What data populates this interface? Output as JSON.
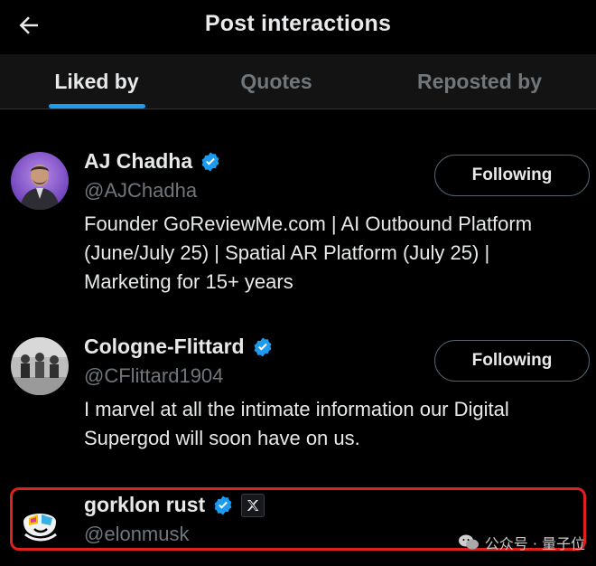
{
  "header": {
    "title": "Post interactions",
    "back_icon": "arrow-left-icon"
  },
  "tabs": [
    {
      "label": "Liked by",
      "active": true
    },
    {
      "label": "Quotes",
      "active": false
    },
    {
      "label": "Reposted by",
      "active": false
    }
  ],
  "users": [
    {
      "name": "AJ Chadha",
      "handle": "@AJChadha",
      "verified": true,
      "bio_lines": [
        "Founder GoReviewMe.com | AI Outbound Platform",
        "(June/July 25) | Spatial AR Platform (July 25) |",
        "Marketing for 15+ years"
      ],
      "button_label": "Following"
    },
    {
      "name": "Cologne-Flittard",
      "handle": "@CFlittard1904",
      "verified": true,
      "bio_lines": [
        "I marvel at all the intimate information our Digital",
        "Supergod will soon have on us."
      ],
      "button_label": "Following"
    },
    {
      "name": "gorklon rust",
      "handle": "@elonmusk",
      "verified": true,
      "affiliate_badge": "x-logo-icon",
      "highlighted": true
    }
  ],
  "watermark": {
    "text": "公众号 · 量子位",
    "icon": "wechat-icon"
  },
  "colors": {
    "background": "#000000",
    "accent": "#1d9bf0",
    "highlight": "#e0201e",
    "secondary_text": "#71767b"
  }
}
